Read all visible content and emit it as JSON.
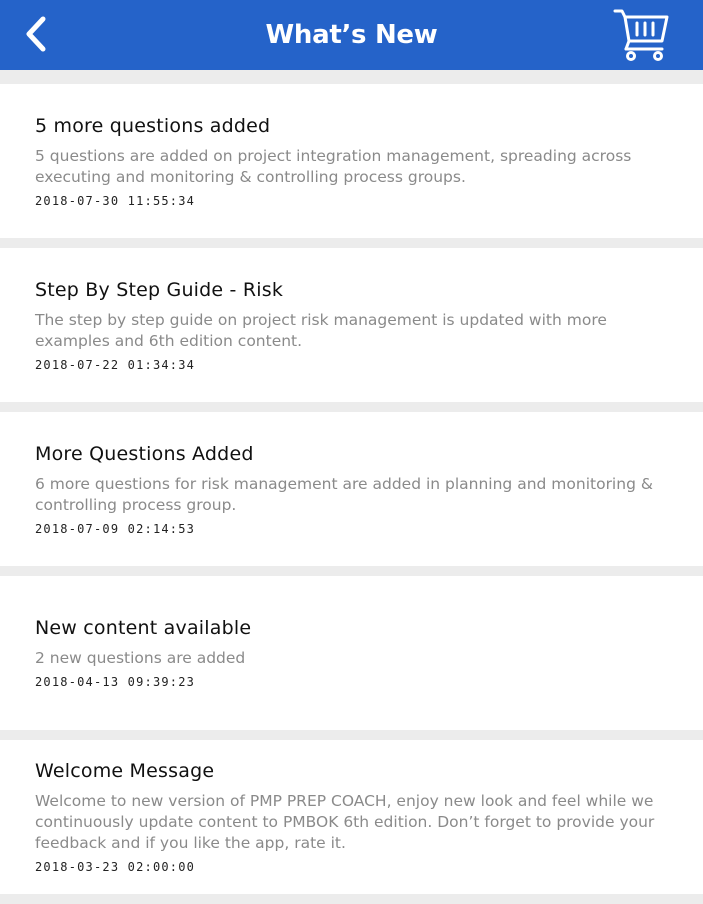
{
  "header": {
    "title": "What’s New",
    "back_icon": "chevron-left-icon",
    "cart_icon": "shopping-cart-icon",
    "background_color": "#2563c9"
  },
  "items": [
    {
      "title": "5 more questions added",
      "body": "5 questions are added on project integration management, spreading across executing and monitoring & controlling process groups.",
      "date": "2018-07-30 11:55:34"
    },
    {
      "title": "Step By Step Guide - Risk",
      "body": "The step by step guide on project risk management is updated with more examples and 6th edition content.",
      "date": "2018-07-22 01:34:34"
    },
    {
      "title": "More Questions Added",
      "body": "6 more questions for risk management are added in planning and monitoring & controlling process group.",
      "date": "2018-07-09 02:14:53"
    },
    {
      "title": "New content available",
      "body": "2 new questions are added",
      "date": "2018-04-13 09:39:23"
    },
    {
      "title": "Welcome Message",
      "body": "Welcome to new version of PMP PREP COACH, enjoy new look and feel while we continuously update content to PMBOK 6th edition. Don’t forget to provide your feedback and if you like the app, rate it.",
      "date": "2018-03-23 02:00:00"
    }
  ]
}
